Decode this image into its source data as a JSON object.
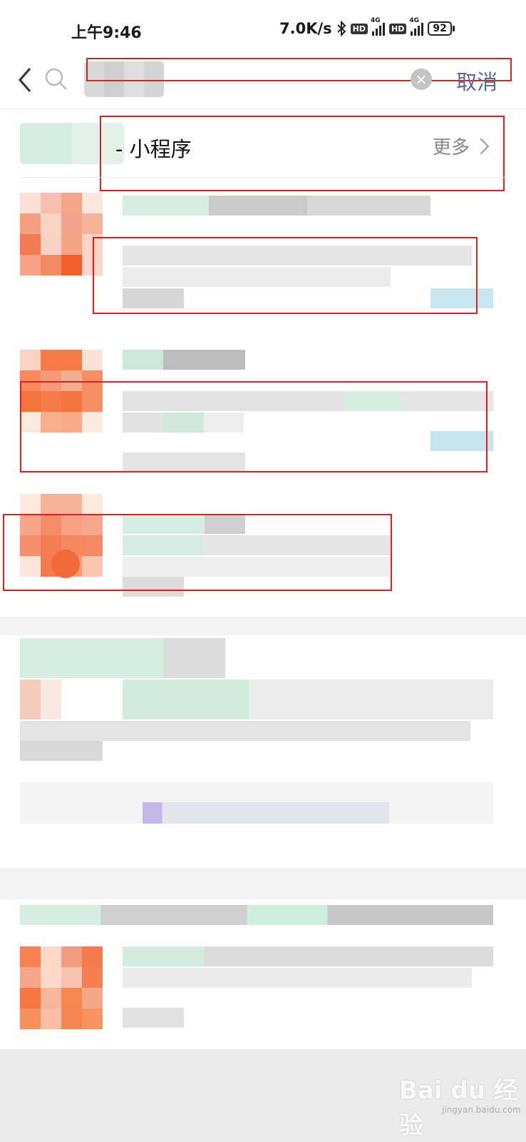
{
  "status_bar": {
    "time": "上午9:46",
    "net_speed": "7.0K/s",
    "hd": "HD",
    "net_type": "4G",
    "battery": "92"
  },
  "search": {
    "placeholder": "",
    "cancel_label": "取消",
    "clear_symbol": "×"
  },
  "section": {
    "title": "- 小程序",
    "more_label": "更多"
  },
  "colors": {
    "link_blue": "#576b95",
    "annotation_red": "#e02020",
    "avatar_orange": "#f4764a"
  },
  "icons": [
    "back-arrow-icon",
    "search-icon",
    "clear-icon",
    "chevron-right-icon",
    "bluetooth-icon",
    "signal-icon",
    "battery-icon"
  ],
  "watermark": {
    "brand": "Bai du 经验",
    "url": "jingyan.baidu.com"
  }
}
